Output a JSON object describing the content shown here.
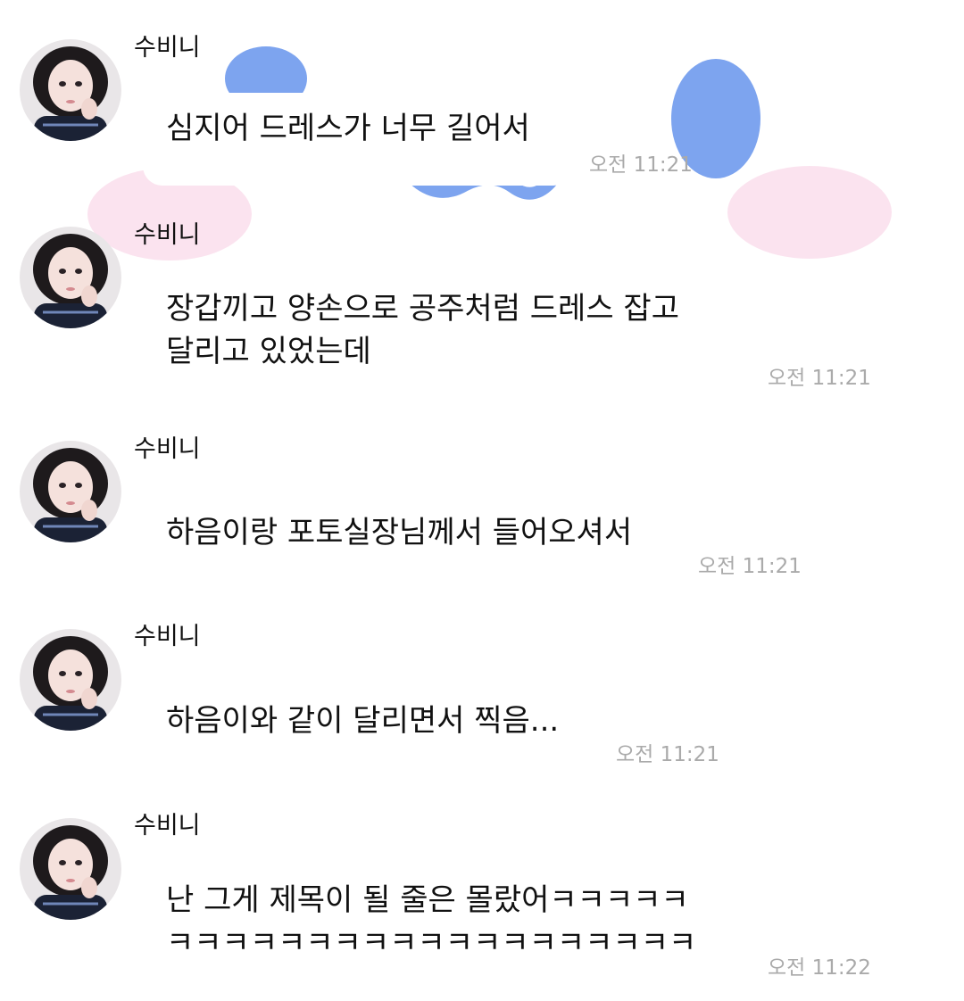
{
  "colors": {
    "background": "#ffffff",
    "deco_blue": "#7da4ef",
    "deco_pink": "#fbe3ef",
    "text": "#111111",
    "time": "#aaaaaa"
  },
  "messages": [
    {
      "sender": "수비니",
      "lines": [
        "심지어 드레스가 너무 길어서"
      ],
      "time": "오전 11:21"
    },
    {
      "sender": "수비니",
      "lines": [
        "장갑끼고 양손으로 공주처럼 드레스 잡고",
        "달리고 있었는데"
      ],
      "time": "오전 11:21"
    },
    {
      "sender": "수비니",
      "lines": [
        "하음이랑 포토실장님께서 들어오셔서"
      ],
      "time": "오전 11:21"
    },
    {
      "sender": "수비니",
      "lines": [
        "하음이와 같이 달리면서 찍음..."
      ],
      "time": "오전 11:21"
    },
    {
      "sender": "수비니",
      "lines": [
        "난 그게 제목이 될 줄은 몰랐어ㅋㅋㅋㅋㅋ",
        "ㅋㅋㅋㅋㅋㅋㅋㅋㅋㅋㅋㅋㅋㅋㅋㅋㅋㅋㅋ"
      ],
      "time": "오전 11:22"
    }
  ]
}
